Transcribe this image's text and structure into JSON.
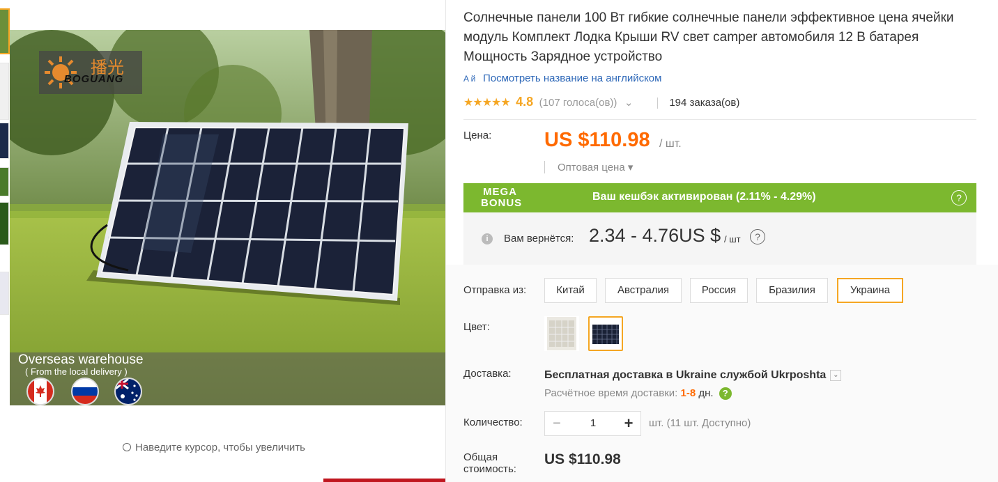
{
  "gallery": {
    "logo_cn": "播光",
    "logo_en": "BOGUANG",
    "overseas_title": "Overseas warehouse",
    "overseas_sub": "( From the local delivery )",
    "flags": [
      "canada-flag-icon",
      "russia-flag-icon",
      "australia-flag-icon"
    ],
    "zoom_hint": "Наведите курсор, чтобы увеличить"
  },
  "product": {
    "title": "Солнечные панели 100 Вт гибкие солнечные панели эффективное цена ячейки модуль Комплект Лодка Крыши RV свет camper автомобиля 12 В батарея Мощность Зарядное устройство",
    "translate_icon": "A й",
    "translate_link": "Посмотреть название на английском",
    "stars": "★★★★★",
    "rating": "4.8",
    "votes": "(107 голоса(ов))",
    "votes_chevron": "⌄",
    "orders": "194 заказа(ов)"
  },
  "price": {
    "label": "Цена:",
    "value": "US $110.98",
    "unit": "/ шт.",
    "bulk": "Оптовая цена ▾"
  },
  "bonus": {
    "logo_line1": "MEGA",
    "logo_line2": "BONUS",
    "text": "Ваш кешбэк активирован (2.11% - 4.29%)",
    "help": "?",
    "info": "i",
    "return_label": "Вам вернётся:",
    "return_value": "2.34 - 4.76US $",
    "return_unit": "/ шт",
    "return_help": "?"
  },
  "shipping_from": {
    "label": "Отправка из:",
    "options": [
      "Китай",
      "Австралия",
      "Россия",
      "Бразилия",
      "Украина"
    ],
    "selected": "Украина"
  },
  "color": {
    "label": "Цвет:"
  },
  "delivery": {
    "label": "Доставка:",
    "main": "Бесплатная доставка в Ukraine службой Ukrposhta",
    "dropdown": "⌄",
    "time_label": "Расчётное время доставки:",
    "time_days": "1-8",
    "time_unit": "дн.",
    "help": "?"
  },
  "quantity": {
    "label": "Количество:",
    "minus": "−",
    "value": "1",
    "plus": "+",
    "available": "шт. (11 шт. Доступно)"
  },
  "total": {
    "label": "Общая стоимость:",
    "value": "US $110.98"
  },
  "colors": {
    "accent": "#ff6a00",
    "selected_border": "#f5a623",
    "bonus_green": "#7cb82f",
    "link": "#2e68b8"
  }
}
